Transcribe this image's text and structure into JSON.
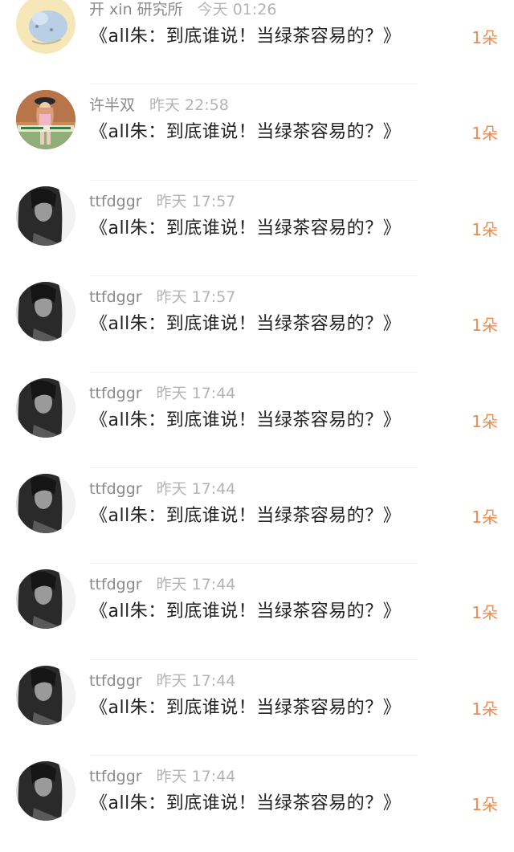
{
  "accent_color": "#f08a4a",
  "messages": [
    {
      "username": "开 xin 研究所",
      "time": "今天 01:26",
      "title": "《all朱：到底谁说！当绿茶容易的？》",
      "count": "1朵",
      "avatar": "cartoon-avatar-icon"
    },
    {
      "username": "许半双",
      "time": "昨天 22:58",
      "title": "《all朱：到底谁说！当绿茶容易的？》",
      "count": "1朵",
      "avatar": "photo-avatar-icon"
    },
    {
      "username": "ttfdggr",
      "time": "昨天 17:57",
      "title": "《all朱：到底谁说！当绿茶容易的？》",
      "count": "1朵",
      "avatar": "bw-portrait-avatar-icon"
    },
    {
      "username": "ttfdggr",
      "time": "昨天 17:57",
      "title": "《all朱：到底谁说！当绿茶容易的？》",
      "count": "1朵",
      "avatar": "bw-portrait-avatar-icon"
    },
    {
      "username": "ttfdggr",
      "time": "昨天 17:44",
      "title": "《all朱：到底谁说！当绿茶容易的？》",
      "count": "1朵",
      "avatar": "bw-portrait-avatar-icon"
    },
    {
      "username": "ttfdggr",
      "time": "昨天 17:44",
      "title": "《all朱：到底谁说！当绿茶容易的？》",
      "count": "1朵",
      "avatar": "bw-portrait-avatar-icon"
    },
    {
      "username": "ttfdggr",
      "time": "昨天 17:44",
      "title": "《all朱：到底谁说！当绿茶容易的？》",
      "count": "1朵",
      "avatar": "bw-portrait-avatar-icon"
    },
    {
      "username": "ttfdggr",
      "time": "昨天 17:44",
      "title": "《all朱：到底谁说！当绿茶容易的？》",
      "count": "1朵",
      "avatar": "bw-portrait-avatar-icon"
    },
    {
      "username": "ttfdggr",
      "time": "昨天 17:44",
      "title": "《all朱：到底谁说！当绿茶容易的？》",
      "count": "1朵",
      "avatar": "bw-portrait-avatar-icon"
    }
  ]
}
